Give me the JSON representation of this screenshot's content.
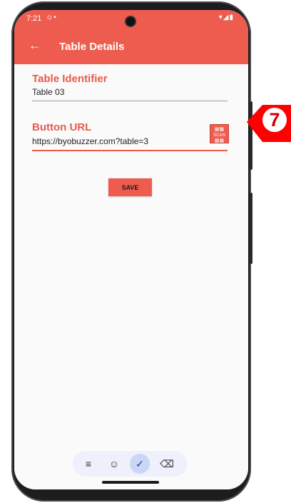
{
  "status_bar": {
    "time": "7:21",
    "left_icons": "⦸ ▪",
    "right_icons": "▾◢▮"
  },
  "app_bar": {
    "back_icon": "back-arrow-icon",
    "title": "Table Details"
  },
  "form": {
    "identifier_label": "Table Identifier",
    "identifier_value": "Table 03",
    "url_label": "Button URL",
    "url_value": "https://byobuzzer.com?table=3",
    "scan_button_text": "SCAN",
    "save_label": "SAVE"
  },
  "keyboard_toolbar": {
    "menu_icon": "≡",
    "emoji_icon": "☺",
    "check_icon": "✓",
    "backspace_icon": "⌫"
  },
  "callout": {
    "number": "7"
  },
  "colors": {
    "accent": "#ee5c4f",
    "label": "#e85a4b",
    "callout": "#ff0000"
  }
}
